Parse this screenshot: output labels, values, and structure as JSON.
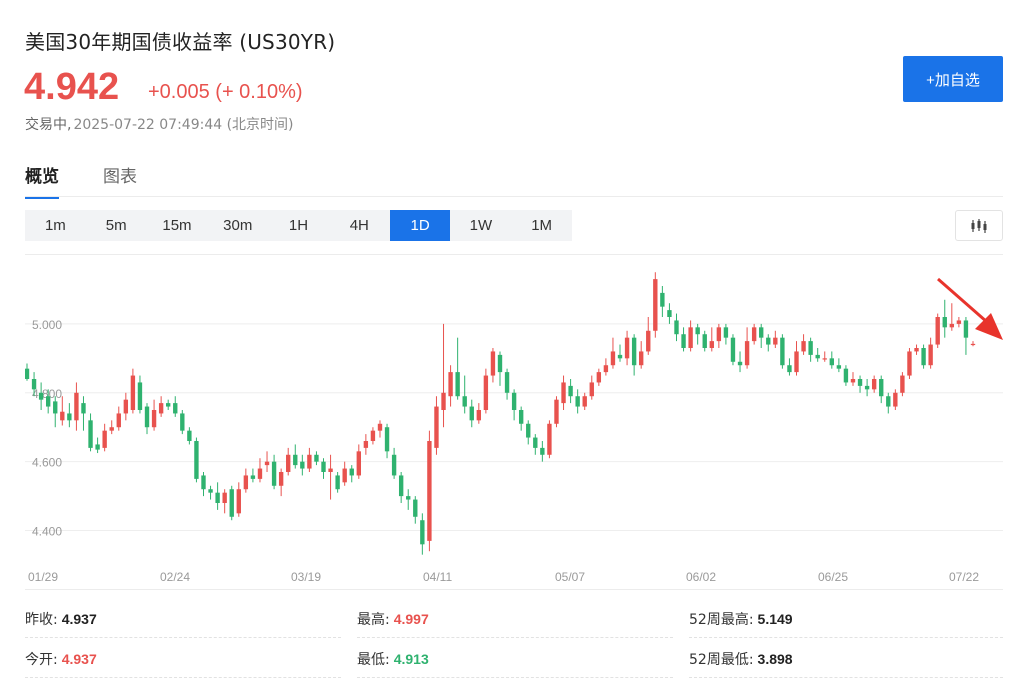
{
  "header": {
    "title": "美国30年期国债收益率 (US30YR)",
    "price": "4.942",
    "change": "+0.005 (+ 0.10%)",
    "status": "交易中,",
    "time": "2025-07-22 07:49:44 (北京时间)",
    "watch_button": "+加自选"
  },
  "tabs": [
    {
      "label": "概览",
      "active": true
    },
    {
      "label": "图表",
      "active": false
    }
  ],
  "periods": [
    {
      "label": "1m",
      "active": false
    },
    {
      "label": "5m",
      "active": false
    },
    {
      "label": "15m",
      "active": false
    },
    {
      "label": "30m",
      "active": false
    },
    {
      "label": "1H",
      "active": false
    },
    {
      "label": "4H",
      "active": false
    },
    {
      "label": "1D",
      "active": true
    },
    {
      "label": "1W",
      "active": false
    },
    {
      "label": "1M",
      "active": false
    }
  ],
  "chart_type_icon": "candlestick-icon",
  "colors": {
    "up": "#e8524e",
    "down": "#2fb26f",
    "accent": "#1a73e8"
  },
  "chart_data": {
    "type": "candlestick",
    "ylim": [
      4.3,
      5.2
    ],
    "yticks": [
      "5.000",
      "4.800",
      "4.600",
      "4.400"
    ],
    "xticks": [
      "01/29",
      "02/24",
      "03/19",
      "04/11",
      "05/07",
      "06/02",
      "06/25",
      "07/22"
    ],
    "candles": [
      [
        4.87,
        4.84,
        4.885,
        4.835
      ],
      [
        4.84,
        4.81,
        4.86,
        4.79
      ],
      [
        4.8,
        4.78,
        4.83,
        4.75
      ],
      [
        4.79,
        4.76,
        4.81,
        4.74
      ],
      [
        4.775,
        4.74,
        4.79,
        4.7
      ],
      [
        4.72,
        4.745,
        4.79,
        4.705
      ],
      [
        4.74,
        4.72,
        4.77,
        4.7
      ],
      [
        4.72,
        4.8,
        4.83,
        4.69
      ],
      [
        4.77,
        4.74,
        4.79,
        4.69
      ],
      [
        4.72,
        4.64,
        4.74,
        4.63
      ],
      [
        4.65,
        4.635,
        4.67,
        4.625
      ],
      [
        4.64,
        4.69,
        4.71,
        4.63
      ],
      [
        4.69,
        4.7,
        4.72,
        4.68
      ],
      [
        4.7,
        4.74,
        4.76,
        4.69
      ],
      [
        4.74,
        4.78,
        4.8,
        4.72
      ],
      [
        4.75,
        4.85,
        4.87,
        4.74
      ],
      [
        4.83,
        4.75,
        4.85,
        4.74
      ],
      [
        4.76,
        4.7,
        4.77,
        4.68
      ],
      [
        4.7,
        4.75,
        4.78,
        4.69
      ],
      [
        4.74,
        4.77,
        4.79,
        4.73
      ],
      [
        4.77,
        4.76,
        4.78,
        4.75
      ],
      [
        4.77,
        4.74,
        4.79,
        4.73
      ],
      [
        4.74,
        4.69,
        4.75,
        4.68
      ],
      [
        4.69,
        4.66,
        4.7,
        4.65
      ],
      [
        4.66,
        4.55,
        4.67,
        4.54
      ],
      [
        4.56,
        4.52,
        4.57,
        4.5
      ],
      [
        4.52,
        4.51,
        4.53,
        4.49
      ],
      [
        4.51,
        4.48,
        4.54,
        4.46
      ],
      [
        4.48,
        4.51,
        4.52,
        4.45
      ],
      [
        4.52,
        4.44,
        4.53,
        4.43
      ],
      [
        4.45,
        4.52,
        4.54,
        4.44
      ],
      [
        4.52,
        4.56,
        4.58,
        4.51
      ],
      [
        4.56,
        4.55,
        4.58,
        4.54
      ],
      [
        4.55,
        4.58,
        4.61,
        4.54
      ],
      [
        4.59,
        4.6,
        4.63,
        4.57
      ],
      [
        4.6,
        4.53,
        4.62,
        4.52
      ],
      [
        4.53,
        4.57,
        4.58,
        4.5
      ],
      [
        4.57,
        4.62,
        4.64,
        4.56
      ],
      [
        4.62,
        4.59,
        4.65,
        4.58
      ],
      [
        4.6,
        4.58,
        4.62,
        4.56
      ],
      [
        4.58,
        4.62,
        4.64,
        4.57
      ],
      [
        4.62,
        4.6,
        4.63,
        4.59
      ],
      [
        4.6,
        4.57,
        4.61,
        4.55
      ],
      [
        4.57,
        4.58,
        4.62,
        4.49
      ],
      [
        4.56,
        4.52,
        4.57,
        4.51
      ],
      [
        4.54,
        4.58,
        4.6,
        4.53
      ],
      [
        4.58,
        4.56,
        4.59,
        4.54
      ],
      [
        4.56,
        4.63,
        4.65,
        4.55
      ],
      [
        4.64,
        4.66,
        4.68,
        4.62
      ],
      [
        4.66,
        4.69,
        4.7,
        4.65
      ],
      [
        4.69,
        4.71,
        4.72,
        4.67
      ],
      [
        4.7,
        4.63,
        4.71,
        4.61
      ],
      [
        4.62,
        4.56,
        4.64,
        4.55
      ],
      [
        4.56,
        4.5,
        4.57,
        4.48
      ],
      [
        4.5,
        4.49,
        4.52,
        4.46
      ],
      [
        4.49,
        4.44,
        4.5,
        4.42
      ],
      [
        4.43,
        4.36,
        4.45,
        4.33
      ],
      [
        4.37,
        4.66,
        4.69,
        4.34
      ],
      [
        4.64,
        4.76,
        4.79,
        4.62
      ],
      [
        4.75,
        4.8,
        5.0,
        4.7
      ],
      [
        4.79,
        4.86,
        4.88,
        4.76
      ],
      [
        4.86,
        4.79,
        4.96,
        4.78
      ],
      [
        4.79,
        4.76,
        4.85,
        4.74
      ],
      [
        4.76,
        4.72,
        4.78,
        4.7
      ],
      [
        4.72,
        4.75,
        4.77,
        4.71
      ],
      [
        4.75,
        4.85,
        4.87,
        4.74
      ],
      [
        4.85,
        4.92,
        4.93,
        4.83
      ],
      [
        4.91,
        4.86,
        4.92,
        4.82
      ],
      [
        4.86,
        4.8,
        4.87,
        4.78
      ],
      [
        4.8,
        4.75,
        4.81,
        4.72
      ],
      [
        4.75,
        4.71,
        4.76,
        4.69
      ],
      [
        4.71,
        4.67,
        4.72,
        4.65
      ],
      [
        4.67,
        4.64,
        4.68,
        4.62
      ],
      [
        4.64,
        4.62,
        4.66,
        4.6
      ],
      [
        4.62,
        4.71,
        4.72,
        4.61
      ],
      [
        4.71,
        4.78,
        4.79,
        4.7
      ],
      [
        4.77,
        4.83,
        4.85,
        4.75
      ],
      [
        4.82,
        4.79,
        4.84,
        4.77
      ],
      [
        4.79,
        4.76,
        4.81,
        4.74
      ],
      [
        4.76,
        4.79,
        4.8,
        4.75
      ],
      [
        4.79,
        4.83,
        4.85,
        4.78
      ],
      [
        4.83,
        4.86,
        4.87,
        4.82
      ],
      [
        4.86,
        4.88,
        4.9,
        4.85
      ],
      [
        4.88,
        4.92,
        4.96,
        4.87
      ],
      [
        4.91,
        4.9,
        4.94,
        4.89
      ],
      [
        4.9,
        4.96,
        4.98,
        4.88
      ],
      [
        4.96,
        4.88,
        4.97,
        4.85
      ],
      [
        4.88,
        4.92,
        4.95,
        4.87
      ],
      [
        4.92,
        4.98,
        5.02,
        4.91
      ],
      [
        4.98,
        5.13,
        5.15,
        4.96
      ],
      [
        5.09,
        5.05,
        5.11,
        5.02
      ],
      [
        5.04,
        5.02,
        5.06,
        5.0
      ],
      [
        5.01,
        4.97,
        5.03,
        4.95
      ],
      [
        4.97,
        4.93,
        4.99,
        4.92
      ],
      [
        4.93,
        4.99,
        5.01,
        4.92
      ],
      [
        4.99,
        4.97,
        5.0,
        4.94
      ],
      [
        4.97,
        4.93,
        4.98,
        4.92
      ],
      [
        4.93,
        4.95,
        4.99,
        4.92
      ],
      [
        4.95,
        4.99,
        5.0,
        4.93
      ],
      [
        4.99,
        4.96,
        5.0,
        4.94
      ],
      [
        4.96,
        4.89,
        4.97,
        4.88
      ],
      [
        4.89,
        4.88,
        4.92,
        4.86
      ],
      [
        4.88,
        4.95,
        4.99,
        4.87
      ],
      [
        4.95,
        4.99,
        5.0,
        4.94
      ],
      [
        4.99,
        4.96,
        5.0,
        4.93
      ],
      [
        4.96,
        4.94,
        4.97,
        4.92
      ],
      [
        4.94,
        4.96,
        4.98,
        4.93
      ],
      [
        4.96,
        4.88,
        4.97,
        4.87
      ],
      [
        4.88,
        4.86,
        4.9,
        4.85
      ],
      [
        4.86,
        4.92,
        4.95,
        4.85
      ],
      [
        4.92,
        4.95,
        4.97,
        4.91
      ],
      [
        4.95,
        4.91,
        4.96,
        4.89
      ],
      [
        4.91,
        4.9,
        4.93,
        4.89
      ],
      [
        4.9,
        4.9,
        4.92,
        4.89
      ],
      [
        4.9,
        4.88,
        4.92,
        4.87
      ],
      [
        4.88,
        4.87,
        4.9,
        4.86
      ],
      [
        4.87,
        4.83,
        4.88,
        4.82
      ],
      [
        4.83,
        4.84,
        4.86,
        4.82
      ],
      [
        4.84,
        4.82,
        4.85,
        4.8
      ],
      [
        4.82,
        4.81,
        4.84,
        4.79
      ],
      [
        4.81,
        4.84,
        4.85,
        4.8
      ],
      [
        4.84,
        4.79,
        4.85,
        4.77
      ],
      [
        4.79,
        4.76,
        4.8,
        4.74
      ],
      [
        4.76,
        4.8,
        4.81,
        4.75
      ],
      [
        4.8,
        4.85,
        4.86,
        4.79
      ],
      [
        4.85,
        4.92,
        4.93,
        4.84
      ],
      [
        4.92,
        4.93,
        4.94,
        4.91
      ],
      [
        4.93,
        4.88,
        4.94,
        4.87
      ],
      [
        4.88,
        4.94,
        4.96,
        4.87
      ],
      [
        4.94,
        5.02,
        5.03,
        4.93
      ],
      [
        5.02,
        4.99,
        5.07,
        4.96
      ],
      [
        4.99,
        5.0,
        5.06,
        4.98
      ],
      [
        5.0,
        5.01,
        5.02,
        4.99
      ],
      [
        5.01,
        4.96,
        5.02,
        4.91
      ],
      [
        4.94,
        4.942,
        4.95,
        4.935
      ]
    ]
  },
  "stats": [
    [
      {
        "label": "昨收:",
        "value": "4.937",
        "tone": "neutral"
      },
      {
        "label": "最高:",
        "value": "4.997",
        "tone": "up"
      },
      {
        "label": "52周最高:",
        "value": "5.149",
        "tone": "neutral"
      }
    ],
    [
      {
        "label": "今开:",
        "value": "4.937",
        "tone": "up"
      },
      {
        "label": "最低:",
        "value": "4.913",
        "tone": "down"
      },
      {
        "label": "52周最低:",
        "value": "3.898",
        "tone": "neutral"
      }
    ]
  ]
}
